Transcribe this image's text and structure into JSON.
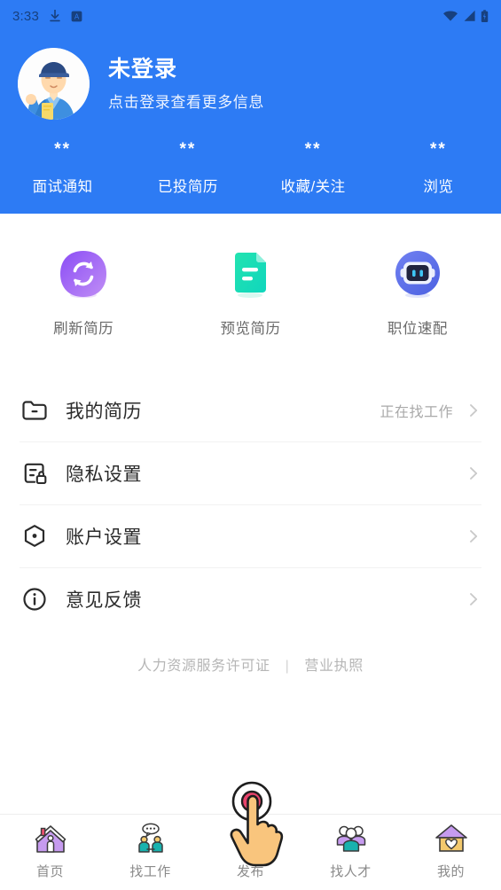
{
  "status_bar": {
    "time": "3:33",
    "left_icons": [
      "download-icon",
      "app-badge-icon"
    ],
    "right_icons": [
      "wifi-icon",
      "cellular-signal-icon",
      "battery-icon"
    ]
  },
  "header": {
    "background_color": "#2d7bf4",
    "avatar_alt": "user-avatar-worker-illustration",
    "title": "未登录",
    "subtitle": "点击登录查看更多信息",
    "stats": [
      {
        "value": "**",
        "label": "面试通知"
      },
      {
        "value": "**",
        "label": "已投简历"
      },
      {
        "value": "**",
        "label": "收藏/关注"
      },
      {
        "value": "**",
        "label": "浏览"
      }
    ]
  },
  "quick_actions": [
    {
      "icon": "refresh-resume-icon",
      "label": "刷新简历",
      "color": "#9b5cf0"
    },
    {
      "icon": "preview-resume-icon",
      "label": "预览简历",
      "color": "#18e0b4"
    },
    {
      "icon": "job-match-robot-icon",
      "label": "职位速配",
      "color": "#5468e8"
    }
  ],
  "menu": [
    {
      "icon": "folder-resume-icon",
      "label": "我的简历",
      "value": "正在找工作"
    },
    {
      "icon": "privacy-lock-icon",
      "label": "隐私设置",
      "value": ""
    },
    {
      "icon": "account-hexagon-icon",
      "label": "账户设置",
      "value": ""
    },
    {
      "icon": "info-circle-icon",
      "label": "意见反馈",
      "value": ""
    }
  ],
  "footer": {
    "link_left": "人力资源服务许可证",
    "separator": "|",
    "link_right": "营业执照"
  },
  "tabbar": [
    {
      "icon": "home-icon",
      "label": "首页"
    },
    {
      "icon": "find-job-icon",
      "label": "找工作"
    },
    {
      "icon": "publish-icon",
      "label": "发布"
    },
    {
      "icon": "find-talent-icon",
      "label": "找人才"
    },
    {
      "icon": "profile-house-icon",
      "label": "我的"
    }
  ],
  "cursor": {
    "type": "tap-hand-cursor",
    "target_label": "发布"
  }
}
